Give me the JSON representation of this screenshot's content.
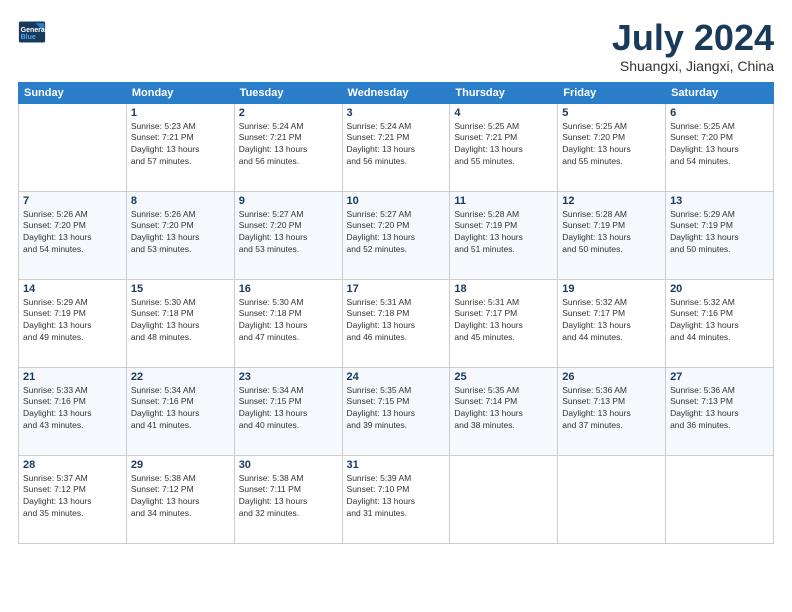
{
  "logo": {
    "line1": "General",
    "line2": "Blue"
  },
  "title": "July 2024",
  "location": "Shuangxi, Jiangxi, China",
  "headers": [
    "Sunday",
    "Monday",
    "Tuesday",
    "Wednesday",
    "Thursday",
    "Friday",
    "Saturday"
  ],
  "weeks": [
    [
      {
        "day": "",
        "info": ""
      },
      {
        "day": "1",
        "info": "Sunrise: 5:23 AM\nSunset: 7:21 PM\nDaylight: 13 hours\nand 57 minutes."
      },
      {
        "day": "2",
        "info": "Sunrise: 5:24 AM\nSunset: 7:21 PM\nDaylight: 13 hours\nand 56 minutes."
      },
      {
        "day": "3",
        "info": "Sunrise: 5:24 AM\nSunset: 7:21 PM\nDaylight: 13 hours\nand 56 minutes."
      },
      {
        "day": "4",
        "info": "Sunrise: 5:25 AM\nSunset: 7:21 PM\nDaylight: 13 hours\nand 55 minutes."
      },
      {
        "day": "5",
        "info": "Sunrise: 5:25 AM\nSunset: 7:20 PM\nDaylight: 13 hours\nand 55 minutes."
      },
      {
        "day": "6",
        "info": "Sunrise: 5:25 AM\nSunset: 7:20 PM\nDaylight: 13 hours\nand 54 minutes."
      }
    ],
    [
      {
        "day": "7",
        "info": "Sunrise: 5:26 AM\nSunset: 7:20 PM\nDaylight: 13 hours\nand 54 minutes."
      },
      {
        "day": "8",
        "info": "Sunrise: 5:26 AM\nSunset: 7:20 PM\nDaylight: 13 hours\nand 53 minutes."
      },
      {
        "day": "9",
        "info": "Sunrise: 5:27 AM\nSunset: 7:20 PM\nDaylight: 13 hours\nand 53 minutes."
      },
      {
        "day": "10",
        "info": "Sunrise: 5:27 AM\nSunset: 7:20 PM\nDaylight: 13 hours\nand 52 minutes."
      },
      {
        "day": "11",
        "info": "Sunrise: 5:28 AM\nSunset: 7:19 PM\nDaylight: 13 hours\nand 51 minutes."
      },
      {
        "day": "12",
        "info": "Sunrise: 5:28 AM\nSunset: 7:19 PM\nDaylight: 13 hours\nand 50 minutes."
      },
      {
        "day": "13",
        "info": "Sunrise: 5:29 AM\nSunset: 7:19 PM\nDaylight: 13 hours\nand 50 minutes."
      }
    ],
    [
      {
        "day": "14",
        "info": "Sunrise: 5:29 AM\nSunset: 7:19 PM\nDaylight: 13 hours\nand 49 minutes."
      },
      {
        "day": "15",
        "info": "Sunrise: 5:30 AM\nSunset: 7:18 PM\nDaylight: 13 hours\nand 48 minutes."
      },
      {
        "day": "16",
        "info": "Sunrise: 5:30 AM\nSunset: 7:18 PM\nDaylight: 13 hours\nand 47 minutes."
      },
      {
        "day": "17",
        "info": "Sunrise: 5:31 AM\nSunset: 7:18 PM\nDaylight: 13 hours\nand 46 minutes."
      },
      {
        "day": "18",
        "info": "Sunrise: 5:31 AM\nSunset: 7:17 PM\nDaylight: 13 hours\nand 45 minutes."
      },
      {
        "day": "19",
        "info": "Sunrise: 5:32 AM\nSunset: 7:17 PM\nDaylight: 13 hours\nand 44 minutes."
      },
      {
        "day": "20",
        "info": "Sunrise: 5:32 AM\nSunset: 7:16 PM\nDaylight: 13 hours\nand 44 minutes."
      }
    ],
    [
      {
        "day": "21",
        "info": "Sunrise: 5:33 AM\nSunset: 7:16 PM\nDaylight: 13 hours\nand 43 minutes."
      },
      {
        "day": "22",
        "info": "Sunrise: 5:34 AM\nSunset: 7:16 PM\nDaylight: 13 hours\nand 41 minutes."
      },
      {
        "day": "23",
        "info": "Sunrise: 5:34 AM\nSunset: 7:15 PM\nDaylight: 13 hours\nand 40 minutes."
      },
      {
        "day": "24",
        "info": "Sunrise: 5:35 AM\nSunset: 7:15 PM\nDaylight: 13 hours\nand 39 minutes."
      },
      {
        "day": "25",
        "info": "Sunrise: 5:35 AM\nSunset: 7:14 PM\nDaylight: 13 hours\nand 38 minutes."
      },
      {
        "day": "26",
        "info": "Sunrise: 5:36 AM\nSunset: 7:13 PM\nDaylight: 13 hours\nand 37 minutes."
      },
      {
        "day": "27",
        "info": "Sunrise: 5:36 AM\nSunset: 7:13 PM\nDaylight: 13 hours\nand 36 minutes."
      }
    ],
    [
      {
        "day": "28",
        "info": "Sunrise: 5:37 AM\nSunset: 7:12 PM\nDaylight: 13 hours\nand 35 minutes."
      },
      {
        "day": "29",
        "info": "Sunrise: 5:38 AM\nSunset: 7:12 PM\nDaylight: 13 hours\nand 34 minutes."
      },
      {
        "day": "30",
        "info": "Sunrise: 5:38 AM\nSunset: 7:11 PM\nDaylight: 13 hours\nand 32 minutes."
      },
      {
        "day": "31",
        "info": "Sunrise: 5:39 AM\nSunset: 7:10 PM\nDaylight: 13 hours\nand 31 minutes."
      },
      {
        "day": "",
        "info": ""
      },
      {
        "day": "",
        "info": ""
      },
      {
        "day": "",
        "info": ""
      }
    ]
  ]
}
